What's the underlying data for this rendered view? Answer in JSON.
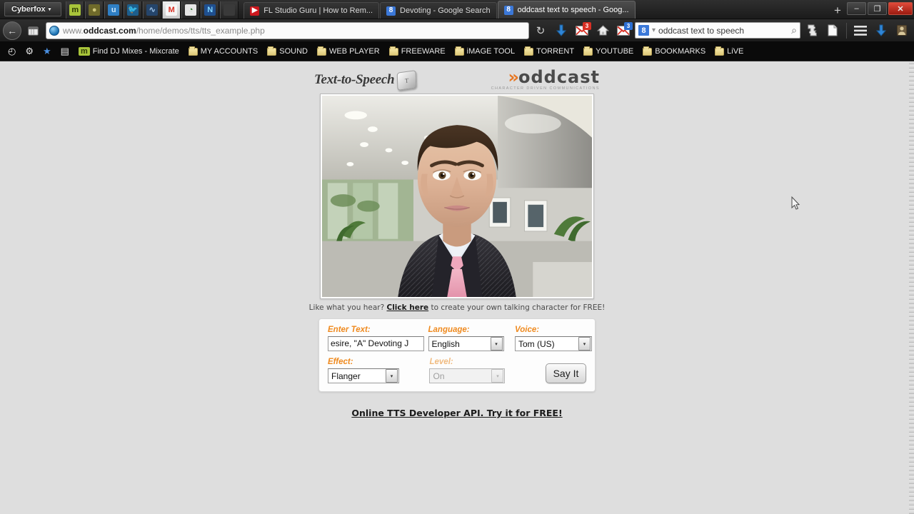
{
  "browser": {
    "app_button": {
      "label": "Cyberfox",
      "caret": "▾"
    },
    "app_icons": [
      {
        "name": "mixcrate-app-icon",
        "glyph": "m",
        "color": "#a8c43a",
        "text_color": "#2e3a06",
        "active": false
      },
      {
        "name": "olive-app-icon",
        "glyph": "●",
        "color": "#6f6a2a",
        "text_color": "#cfc77a",
        "active": false
      },
      {
        "name": "blue-u-app-icon",
        "glyph": "u",
        "color": "#2f7fc4",
        "text_color": "#cfe8fb",
        "active": false
      },
      {
        "name": "twitter-app-icon",
        "glyph": "🐦",
        "color": "#1d5e8c",
        "text_color": "#6fd0ff",
        "active": false
      },
      {
        "name": "blue-swirl-app-icon",
        "glyph": "∿",
        "color": "#25456b",
        "text_color": "#9fc4e8",
        "active": false
      },
      {
        "name": "gmail-app-icon",
        "glyph": "M",
        "color": "#f6f6f6",
        "text_color": "#d93025",
        "active": true
      },
      {
        "name": "green-circle-app-icon",
        "glyph": "◔",
        "color": "#e6e6e6",
        "text_color": "#2f7a2f",
        "active": false
      },
      {
        "name": "blue-n-app-icon",
        "glyph": "N",
        "color": "#1f4f8f",
        "text_color": "#7fd4ff",
        "active": false
      },
      {
        "name": "empty-app-icon",
        "glyph": "",
        "color": "#3a3a3a",
        "text_color": "#3a3a3a",
        "active": false
      }
    ],
    "tabs": [
      {
        "name": "tab-fl-studio-guru",
        "title": "FL Studio Guru | How to Rem...",
        "favicon_glyph": "▶",
        "favicon_color": "#cc181e",
        "selected": false
      },
      {
        "name": "tab-devoting-google-search",
        "title": "Devoting - Google Search",
        "favicon_glyph": "8",
        "favicon_color": "#3b78d8",
        "selected": false
      },
      {
        "name": "tab-oddcast-text-to-speech",
        "title": "oddcast text to speech - Goog...",
        "favicon_glyph": "8",
        "favicon_color": "#3b78d8",
        "selected": true
      }
    ],
    "new_tab_label": "+",
    "window_controls": {
      "minimize": "–",
      "restore": "❐",
      "close": "✕"
    },
    "nav": {
      "back_icon": "←",
      "forward_icon": "→",
      "reload_icon": "↻",
      "url_prefix": "www.",
      "url_domain": "oddcast.com",
      "url_path": "/home/demos/tts/tts_example.php",
      "download_icon": "↓",
      "mail1_badge": "3",
      "mail1_badge_color": "#d93025",
      "mail2_badge": "3",
      "mail2_badge_color": "#2b6fd4",
      "home_icon": "⌂",
      "search_engine_glyph": "8",
      "search_value": "oddcast text to speech",
      "search_magnifier": "⌕",
      "addon_icon": "✥",
      "page_icon": "□",
      "menu_icon": "☰",
      "downloads_icon": "↓",
      "profile_icon": "▤"
    },
    "bookmarks": [
      {
        "name": "bookmark-history",
        "label": "",
        "icon": "clock-icon",
        "glyph": "◴"
      },
      {
        "name": "bookmark-settings",
        "label": "",
        "icon": "gear-icon",
        "glyph": "⚙"
      },
      {
        "name": "bookmark-favorites",
        "label": "",
        "icon": "star-icon",
        "glyph": "★"
      },
      {
        "name": "bookmark-reading-list",
        "label": "",
        "icon": "list-icon",
        "glyph": "▤"
      },
      {
        "name": "bookmark-find-dj-mixes",
        "label": "Find DJ Mixes - Mixcrate",
        "icon": "mixcrate-icon",
        "glyph": "m"
      },
      {
        "name": "bookmark-my-accounts",
        "label": "MY ACCOUNTS",
        "icon": "folder-icon",
        "glyph": ""
      },
      {
        "name": "bookmark-sound",
        "label": "SOUND",
        "icon": "folder-icon",
        "glyph": ""
      },
      {
        "name": "bookmark-web-player",
        "label": "WEB PLAYER",
        "icon": "folder-icon",
        "glyph": ""
      },
      {
        "name": "bookmark-freeware",
        "label": "FREEWARE",
        "icon": "folder-icon",
        "glyph": ""
      },
      {
        "name": "bookmark-image-tool",
        "label": "iMAGE TOOL",
        "icon": "folder-icon",
        "glyph": ""
      },
      {
        "name": "bookmark-torrent",
        "label": "TORRENT",
        "icon": "folder-icon",
        "glyph": ""
      },
      {
        "name": "bookmark-youtube",
        "label": "YOUTUBE",
        "icon": "folder-icon",
        "glyph": ""
      },
      {
        "name": "bookmark-bookmarks",
        "label": "BOOKMARKS",
        "icon": "folder-icon",
        "glyph": ""
      },
      {
        "name": "bookmark-live",
        "label": "LiVE",
        "icon": "folder-icon",
        "glyph": ""
      }
    ]
  },
  "page": {
    "title_text": "Text-to-Speech",
    "keycap_letter": "T",
    "logo": {
      "chevrons": "»",
      "word": "oddcast",
      "registered": "®",
      "tagline": "CHARACTER DRIVEN COMMUNICATIONS"
    },
    "avatar_alt": "male-avatar-in-suit",
    "hear_line": {
      "pre": "Like what you hear? ",
      "link": "Click here",
      "post": " to create your own talking character for FREE!"
    },
    "form": {
      "enter_text_label": "Enter Text:",
      "enter_text_value": "esire, \"A\" Devoting J",
      "language_label": "Language:",
      "language_value": "English",
      "voice_label": "Voice:",
      "voice_value": "Tom (US)",
      "effect_label": "Effect:",
      "effect_value": "Flanger",
      "level_label": "Level:",
      "level_value": "On",
      "say_it_label": "Say It",
      "dropdown_arrow": "▾"
    },
    "api_link": "Online TTS Developer API. Try it for FREE!",
    "colors": {
      "label_orange": "#ef8a1f",
      "brand_orange": "#e87722",
      "page_bg": "#dedede"
    }
  }
}
